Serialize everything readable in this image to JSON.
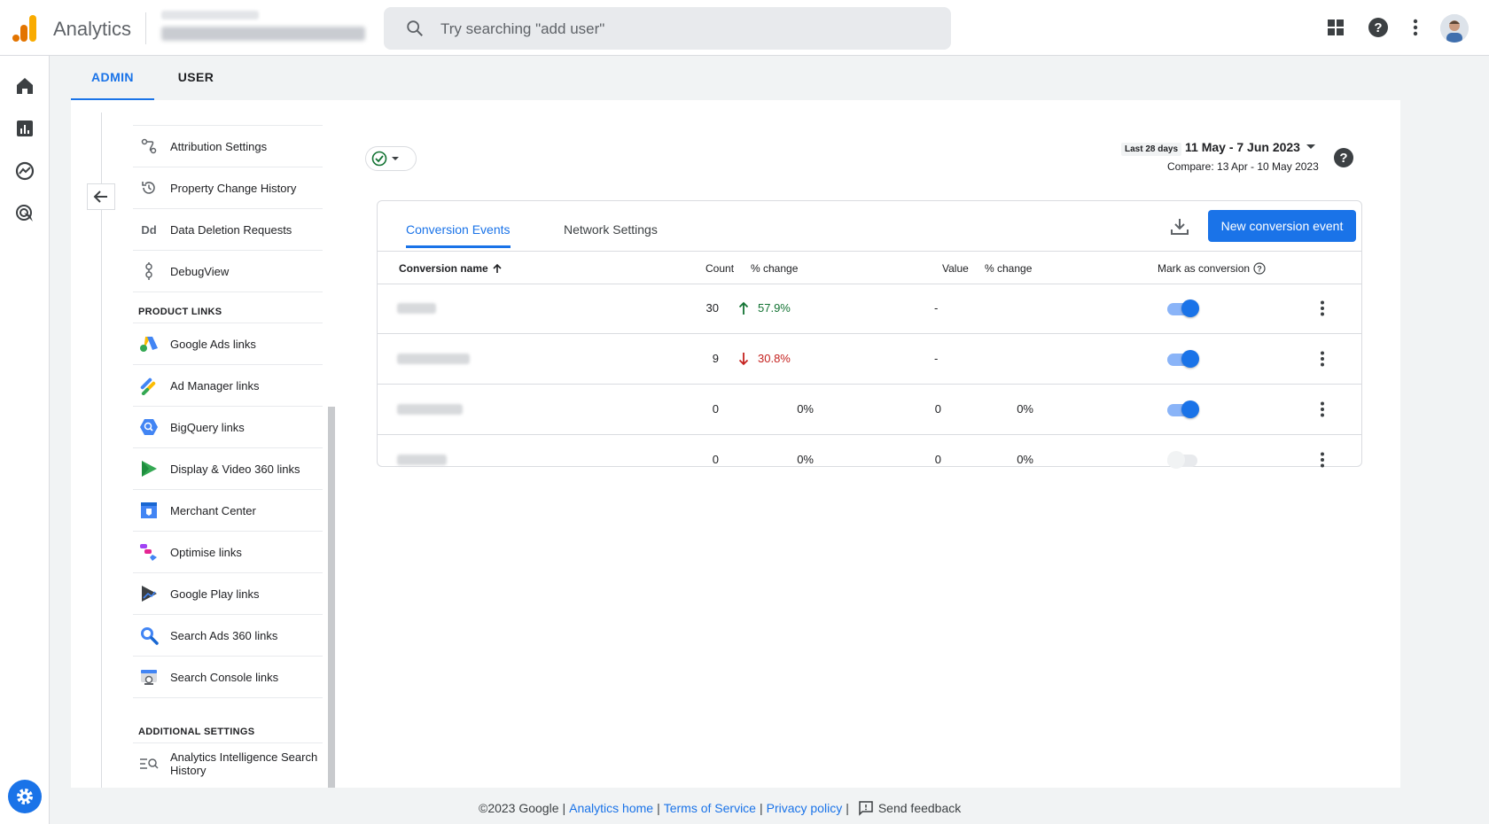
{
  "header": {
    "app_title": "Analytics",
    "search_placeholder": "Try searching \"add user\""
  },
  "admin_tabs": [
    {
      "label": "ADMIN",
      "active": true
    },
    {
      "label": "USER",
      "active": false
    }
  ],
  "nav": {
    "items_top": [
      {
        "label": "Attribution Settings",
        "icon": "attribution-icon"
      },
      {
        "label": "Property Change History",
        "icon": "history-icon"
      },
      {
        "label": "Data Deletion Requests",
        "icon": "data-deletion-icon",
        "icon_text": "Dd"
      },
      {
        "label": "DebugView",
        "icon": "debug-icon"
      }
    ],
    "product_links_title": "PRODUCT LINKS",
    "product_links": [
      {
        "label": "Google Ads links",
        "icon": "google-ads-icon"
      },
      {
        "label": "Ad Manager links",
        "icon": "ad-manager-icon"
      },
      {
        "label": "BigQuery links",
        "icon": "bigquery-icon"
      },
      {
        "label": "Display & Video 360 links",
        "icon": "display-video-icon"
      },
      {
        "label": "Merchant Center",
        "icon": "merchant-center-icon"
      },
      {
        "label": "Optimise links",
        "icon": "optimise-icon"
      },
      {
        "label": "Google Play links",
        "icon": "google-play-icon"
      },
      {
        "label": "Search Ads 360 links",
        "icon": "search-ads-icon"
      },
      {
        "label": "Search Console links",
        "icon": "search-console-icon"
      }
    ],
    "additional_settings_title": "ADDITIONAL SETTINGS",
    "additional_settings": [
      {
        "label": "Analytics Intelligence Search History",
        "icon": "search-history-icon"
      }
    ]
  },
  "date": {
    "badge": "Last 28 days",
    "range": "11 May - 7 Jun 2023",
    "compare": "Compare: 13 Apr - 10 May 2023"
  },
  "table": {
    "tabs": [
      {
        "label": "Conversion Events",
        "active": true
      },
      {
        "label": "Network Settings",
        "active": false
      }
    ],
    "new_button_label": "New conversion event",
    "headers": {
      "name": "Conversion name",
      "count": "Count",
      "count_change": "% change",
      "value": "Value",
      "value_change": "% change",
      "mark": "Mark as conversion"
    },
    "rows": [
      {
        "count": "30",
        "count_change": "57.9%",
        "trend": "up",
        "value": "-",
        "value_change": "",
        "marked": true
      },
      {
        "count": "9",
        "count_change": "30.8%",
        "trend": "down",
        "value": "-",
        "value_change": "",
        "marked": true
      },
      {
        "count": "0",
        "count_change": "0%",
        "trend": "none",
        "value": "0",
        "value_change": "0%",
        "marked": true
      },
      {
        "count": "0",
        "count_change": "0%",
        "trend": "none",
        "value": "0",
        "value_change": "0%",
        "marked": false
      }
    ]
  },
  "footer": {
    "copyright": "©2023 Google",
    "analytics_home": "Analytics home",
    "terms": "Terms of Service",
    "privacy": "Privacy policy",
    "feedback": "Send feedback"
  },
  "colors": {
    "accent": "#1a73e8",
    "positive": "#137333",
    "negative": "#c5221f"
  }
}
